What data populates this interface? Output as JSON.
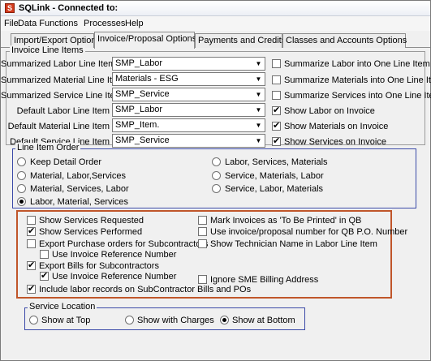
{
  "window": {
    "title": "SQLink - Connected to:",
    "app_icon_glyph": "S"
  },
  "menu": {
    "file": "File",
    "data_functions": "Data Functions",
    "processes": "Processes",
    "help": "Help"
  },
  "tabs": [
    {
      "label": "Import/Export Options",
      "active": false
    },
    {
      "label": "Invoice/Proposal Options",
      "active": true
    },
    {
      "label": "Payments and Credits",
      "active": false
    },
    {
      "label": "Classes and Accounts Options",
      "active": false
    }
  ],
  "invoice_line_items": {
    "title": "Invoice Line Items",
    "rows": [
      {
        "label": "Summarized Labor Line Item",
        "value": "SMP_Labor",
        "check_label": "Summarize Labor into One Line Item",
        "checked": false
      },
      {
        "label": "Summarized Material Line Item",
        "value": "Materials - ESG",
        "check_label": "Summarize Materials into One Line Item",
        "checked": false
      },
      {
        "label": "Summarized Service Line Item",
        "value": "SMP_Service",
        "check_label": "Summarize Services into One Line Item",
        "checked": false
      },
      {
        "label": "Default Labor Line Item",
        "value": "SMP_Labor",
        "check_label": "Show Labor on Invoice",
        "checked": true
      },
      {
        "label": "Default Material Line Item",
        "value": "SMP_Item.",
        "check_label": "Show Materials on Invoice",
        "checked": true
      },
      {
        "label": "Default Service Line Item",
        "value": "SMP_Service",
        "check_label": "Show Services on Invoice",
        "checked": true
      }
    ]
  },
  "line_item_order": {
    "title": "Line Item Order",
    "options": [
      {
        "label": "Keep Detail Order",
        "checked": false
      },
      {
        "label": "Material, Labor,Services",
        "checked": false
      },
      {
        "label": "Material, Services, Labor",
        "checked": false
      },
      {
        "label": "Labor, Material, Services",
        "checked": true
      },
      {
        "label": "Labor, Services, Materials",
        "checked": false
      },
      {
        "label": "Service, Materials, Labor",
        "checked": false
      },
      {
        "label": "Service, Labor, Materials",
        "checked": false
      }
    ]
  },
  "options": {
    "show_services_requested": {
      "label": "Show Services Requested",
      "checked": false
    },
    "show_services_performed": {
      "label": "Show Services Performed",
      "checked": true
    },
    "export_purchase_orders": {
      "label": "Export Purchase orders for Subcontractors",
      "checked": false
    },
    "po_use_invoice_ref": {
      "label": "Use Invoice Reference Number",
      "checked": false
    },
    "export_bills": {
      "label": "Export Bills for Subcontractors",
      "checked": true
    },
    "bills_use_invoice_ref": {
      "label": "Use Invoice Reference Number",
      "checked": true
    },
    "include_labor_records": {
      "label": "Include labor records on SubContractor Bills and POs",
      "checked": true
    },
    "mark_to_be_printed": {
      "label": "Mark Invoices as 'To Be Printed' in QB",
      "checked": false
    },
    "use_invoice_number_po": {
      "label": "Use invoice/proposal number for QB P.O. Number",
      "checked": false
    },
    "show_technician_name": {
      "label": "Show Technician Name in Labor Line Item",
      "checked": false
    },
    "ignore_sme_billing": {
      "label": "Ignore SME Billing Address",
      "checked": false
    }
  },
  "service_location": {
    "title": "Service Location",
    "options": [
      {
        "label": "Show at Top",
        "checked": false
      },
      {
        "label": "Show with Charges",
        "checked": false
      },
      {
        "label": "Show at Bottom",
        "checked": true
      }
    ]
  },
  "colors": {
    "orange_border": "#c0562a",
    "blue_border": "#3b4aa8"
  }
}
